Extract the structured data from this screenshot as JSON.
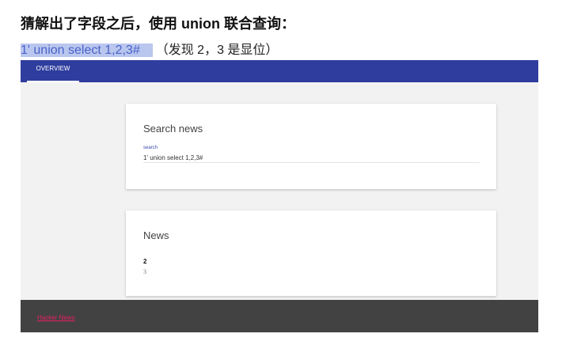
{
  "doc": {
    "heading": "猜解出了字段之后，使用 union 联合查询：",
    "query_highlight": "1' union select 1,2,3#",
    "note": "（发现 2，3 是显位）"
  },
  "app": {
    "colors": {
      "primary": "#2f3d9e",
      "footer": "#424242",
      "link": "#e91e63",
      "background": "#f2f2f2"
    },
    "nav": {
      "tabs": [
        {
          "label": "OVERVIEW",
          "active": true
        }
      ]
    },
    "search_card": {
      "title": "Search news",
      "field_label": "search",
      "field_value": "1' union select 1,2,3#"
    },
    "news_card": {
      "title": "News",
      "items": [
        "2",
        "3"
      ]
    },
    "footer": {
      "link": "Hacker News"
    }
  }
}
